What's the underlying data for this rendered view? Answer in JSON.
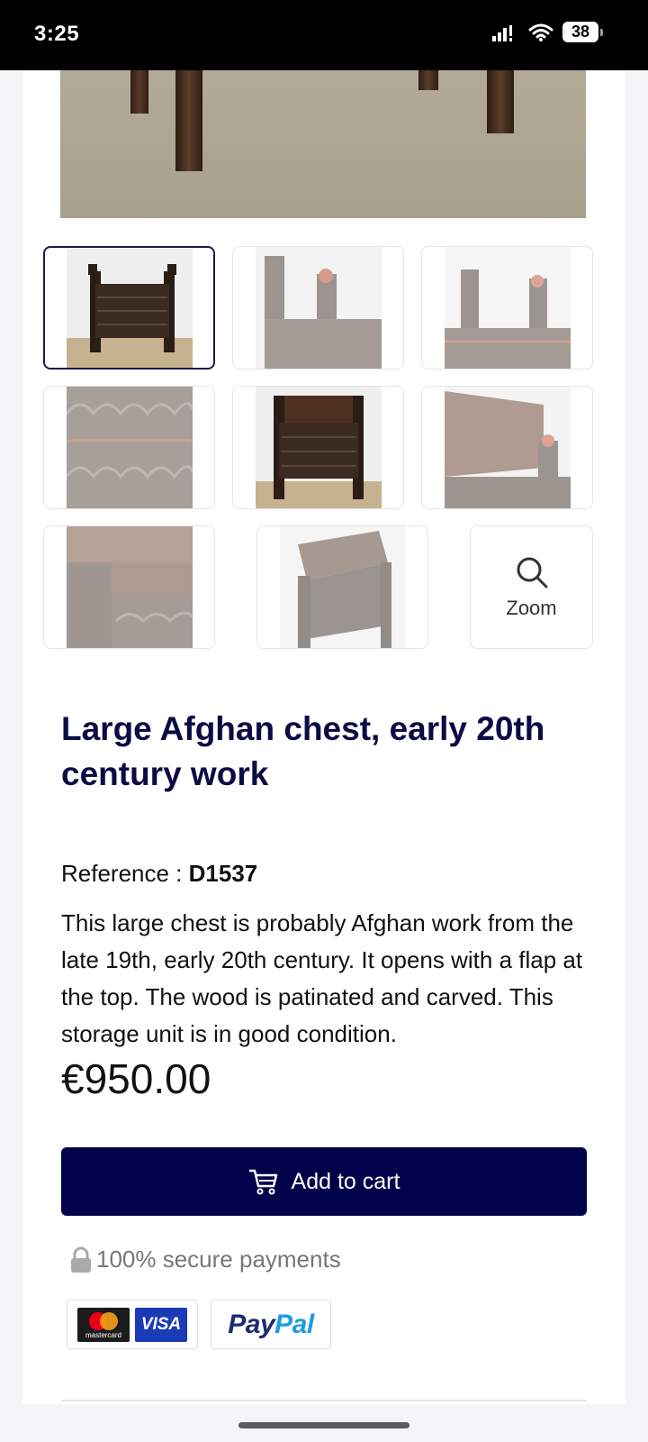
{
  "status_bar": {
    "time": "3:25",
    "battery": "38"
  },
  "zoom_label": "Zoom",
  "product": {
    "title": "Large Afghan chest, early 20th century work",
    "reference_label": "Reference :",
    "reference_value": "D1537",
    "description": "This large chest is probably Afghan work from the late 19th, early 20th century. It opens with a flap at the top. The wood is patinated and carved. This storage unit is in good condition.",
    "price": "€950.00",
    "add_to_cart": "Add to cart"
  },
  "payments": {
    "secure_text": "100% secure payments",
    "mastercard_label": "mastercard",
    "visa_label": "VISA",
    "paypal_pay": "Pay",
    "paypal_pal": "Pal"
  },
  "colors": {
    "accent": "#02024a",
    "title": "#0b0b45",
    "paypal_dark": "#1b2b6f",
    "paypal_light": "#1a9de0"
  }
}
